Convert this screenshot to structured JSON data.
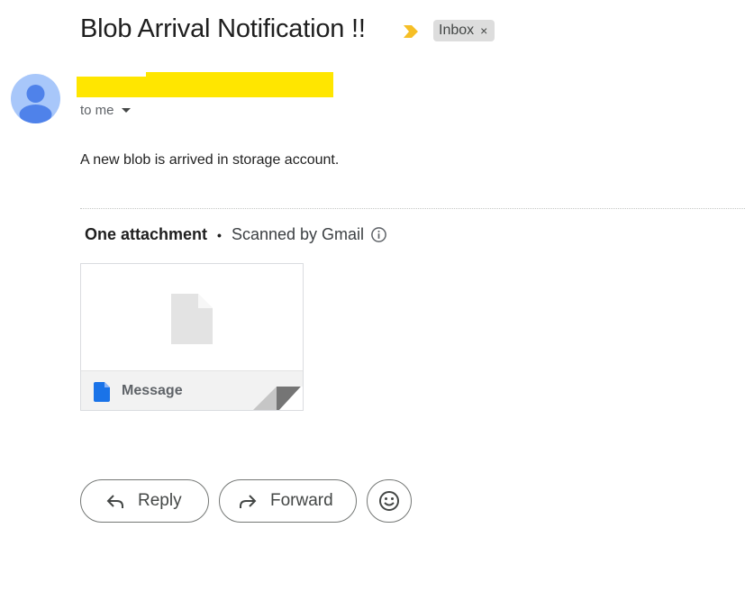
{
  "email": {
    "subject": "Blob Arrival Notification !!",
    "label": "Inbox",
    "label_remove": "×",
    "recipient_text": "to me",
    "body": "A new blob is arrived in storage account."
  },
  "attachments": {
    "title": "One attachment",
    "separator": "•",
    "scanned_text": "Scanned by Gmail",
    "items": [
      {
        "name": "Message",
        "icon": "google-doc-icon"
      }
    ]
  },
  "actions": {
    "reply_label": "Reply",
    "forward_label": "Forward",
    "emoji_icon": "smiley-icon"
  },
  "colors": {
    "importance_marker": "#f6bf26",
    "redaction": "#ffe600",
    "avatar_bg": "#a8c7fa",
    "avatar_fg": "#4285f4",
    "doc_icon": "#1a73e8"
  }
}
